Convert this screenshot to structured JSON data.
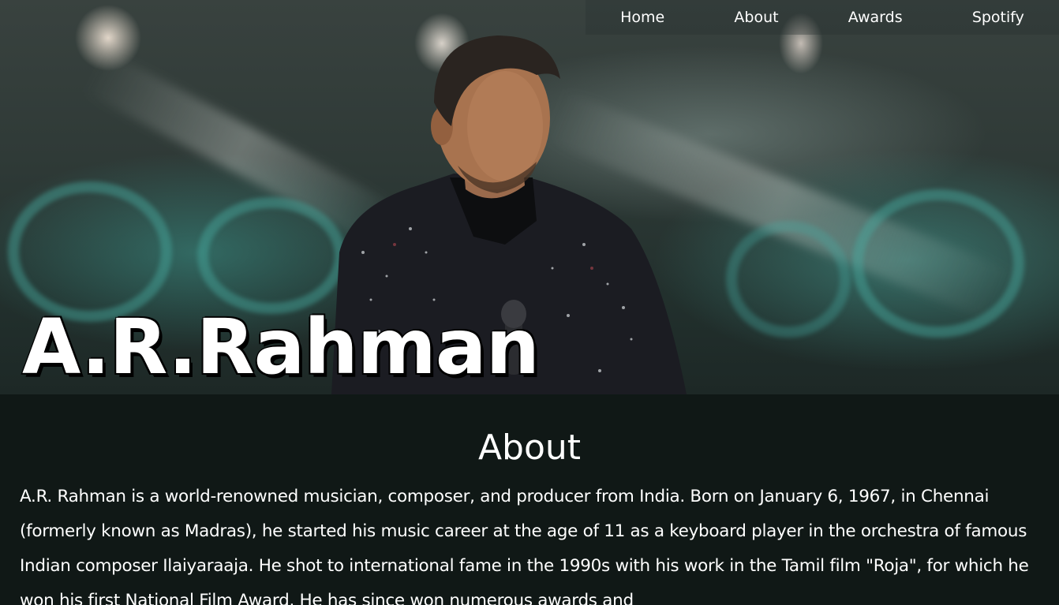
{
  "nav": {
    "items": [
      {
        "label": "Home"
      },
      {
        "label": "About"
      },
      {
        "label": "Awards"
      },
      {
        "label": "Spotify"
      }
    ]
  },
  "hero": {
    "title": "A.R.Rahman"
  },
  "about": {
    "heading": "About",
    "text": "A.R. Rahman is a world-renowned musician, composer, and producer from India. Born on January 6, 1967, in Chennai (formerly known as Madras), he started his music career at the age of 11 as a keyboard player in the orchestra of famous Indian composer Ilaiyaraaja. He shot to international fame in the 1990s with his work in the Tamil film \"Roja\", for which he won his first National Film Award. He has since won numerous awards and"
  },
  "colors": {
    "page_background": "#101816",
    "text": "#ffffff"
  }
}
